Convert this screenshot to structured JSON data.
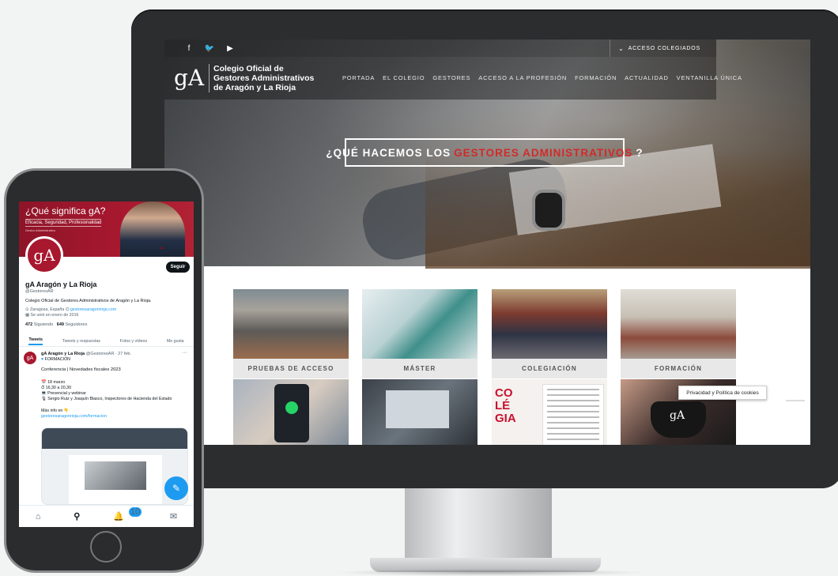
{
  "website": {
    "social_icons": [
      "f",
      "🐦",
      "▶"
    ],
    "access_label": "ACCESO COLEGIADOS",
    "logo_letters": "gA",
    "logo_lines": [
      "Colegio Oficial de",
      "Gestores Administrativos",
      "de Aragón y La Rioja"
    ],
    "menu": [
      "PORTADA",
      "EL COLEGIO",
      "GESTORES",
      "ACCESO A LA PROFESIÓN",
      "FORMACIÓN",
      "ACTUALIDAD",
      "VENTANILLA ÚNICA"
    ],
    "hero": {
      "pre": "¿QUÉ HACEMOS LOS",
      "highlight": "GESTORES ADMINISTRATIVOS",
      "post": "?"
    },
    "cards": [
      "PRUEBAS DE ACCESO",
      "MÁSTER",
      "COLEGIACIÓN",
      "FORMACIÓN"
    ],
    "magazine_text": "CO\nLÉ\nGIA",
    "mask_logo": "gA",
    "cookie_label": "Privacidad y Política de cookies"
  },
  "twitter": {
    "banner_title": "¿Qué significa gA?",
    "banner_sub": "Eficacia, Seguridad, Profesionalidad",
    "banner_sub2": "Gestor Administrativo",
    "avatar_letters": "gA",
    "follow_label": "Seguir",
    "name": "gA Aragón y La Rioja",
    "handle": "@GestoresAR",
    "bio": "Colegio Oficial de Gestores Administrativos de Aragón y La Rioja.",
    "location": "Zaragoza, España",
    "url": "gestoresaragonrioja.com",
    "joined": "Se unió en enero de 2016",
    "following_count": "472",
    "following_label": "Siguiendo",
    "followers_count": "649",
    "followers_label": "Seguidores",
    "tabs": [
      "Tweets",
      "Tweets y respuestas",
      "Fotos y vídeos",
      "Me gusta"
    ],
    "tweet": {
      "author": "gA Aragón y La Rioja",
      "meta": "@GestoresAR · 27 feb.",
      "tag": "FORMACIÓN",
      "title": "Conferencia | Novedades fiscales 2023",
      "lines": [
        "18 marzo",
        "16,30 a 20,30",
        "Presencial y webinar",
        "Sergio Ruiz y Joaquín Blasco, Inspectores de Hacienda del Estado"
      ],
      "more_info": "Más info en",
      "link": "gestoresaragonrioja.com/formacion"
    },
    "notif_count": "10",
    "nav_icons": [
      "home-icon",
      "search-icon",
      "notifications-icon",
      "messages-icon"
    ]
  },
  "colors": {
    "brand_red": "#a8182f",
    "twitter_blue": "#1d9bf0"
  }
}
